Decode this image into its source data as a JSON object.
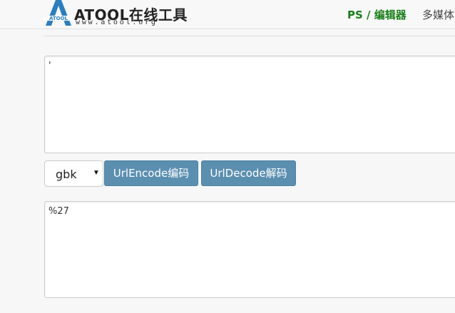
{
  "header": {
    "logo_title": "ATOOL在线工具",
    "logo_subtitle": "www.atool.org",
    "logo_mark_text": "ATOOL",
    "nav": {
      "active_label": "PS / 编辑器",
      "next_label": "多媒体"
    }
  },
  "main": {
    "input_text": "'",
    "encoding_select": {
      "selected": "gbk"
    },
    "buttons": {
      "encode_label": "UrlEncode编码",
      "decode_label": "UrlDecode解码"
    },
    "output_text": "%27"
  },
  "colors": {
    "nav_active": "#1a7f1a",
    "button_bg": "#5b8fb0",
    "logo_blue": "#2a7fc1"
  }
}
